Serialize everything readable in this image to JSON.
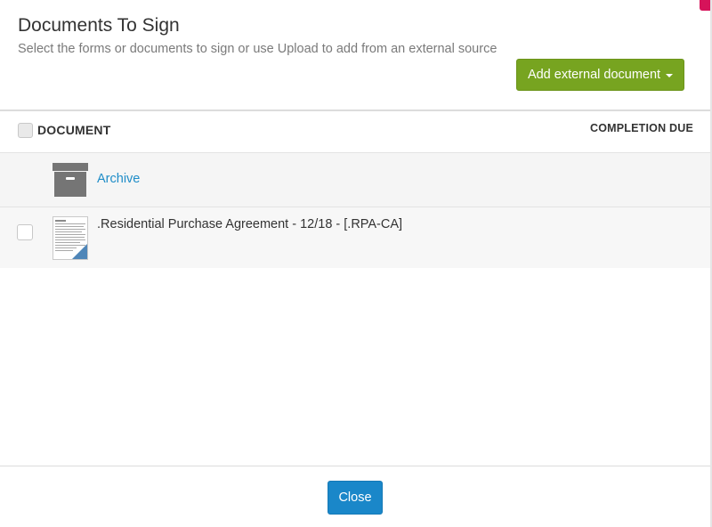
{
  "dialog": {
    "title": "Documents To Sign",
    "subtitle": "Select the forms or documents to sign or use Upload to add from an external source",
    "add_button_label": "Add external document",
    "close_button_label": "Close"
  },
  "table": {
    "columns": {
      "document": "DOCUMENT",
      "completion_due": "COMPLETION DUE"
    },
    "folder": {
      "label": "Archive",
      "icon": "archive-box-icon"
    },
    "rows": [
      {
        "name": ".Residential Purchase Agreement - 12/18 - [.RPA-CA]",
        "checked": false,
        "icon": "document-thumbnail-icon"
      }
    ]
  },
  "colors": {
    "primary_green": "#77a420",
    "primary_blue": "#1a87c9",
    "link_blue": "#1f8dc8",
    "accent_pink": "#d6135a"
  }
}
